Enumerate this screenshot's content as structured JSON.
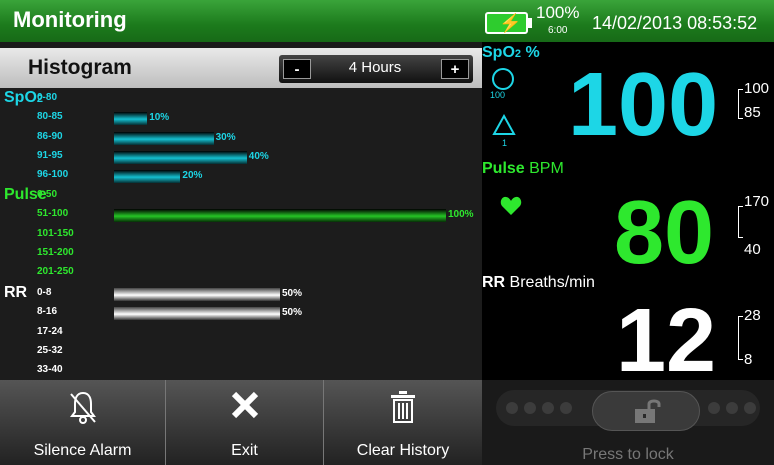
{
  "header": {
    "title": "Monitoring",
    "battery_pct": "100%",
    "battery_time": "6:00",
    "datetime": "14/02/2013 08:53:52"
  },
  "histogram": {
    "title": "Histogram",
    "range_value": "4 Hours",
    "minus_label": "-",
    "plus_label": "+",
    "spo2": {
      "name": "SpO",
      "sub": "2",
      "rows": [
        {
          "label": "0-80",
          "value": 0,
          "pct": ""
        },
        {
          "label": "80-85",
          "value": 10,
          "pct": "10%"
        },
        {
          "label": "86-90",
          "value": 30,
          "pct": "30%"
        },
        {
          "label": "91-95",
          "value": 40,
          "pct": "40%"
        },
        {
          "label": "96-100",
          "value": 20,
          "pct": "20%"
        }
      ]
    },
    "pulse": {
      "name": "Pulse",
      "rows": [
        {
          "label": "0-50",
          "value": 0,
          "pct": ""
        },
        {
          "label": "51-100",
          "value": 100,
          "pct": "100%"
        },
        {
          "label": "101-150",
          "value": 0,
          "pct": ""
        },
        {
          "label": "151-200",
          "value": 0,
          "pct": ""
        },
        {
          "label": "201-250",
          "value": 0,
          "pct": ""
        }
      ]
    },
    "rr": {
      "name": "RR",
      "rows": [
        {
          "label": "0-8",
          "value": 50,
          "pct": "50%"
        },
        {
          "label": "8-16",
          "value": 50,
          "pct": "50%"
        },
        {
          "label": "17-24",
          "value": 0,
          "pct": ""
        },
        {
          "label": "25-32",
          "value": 0,
          "pct": ""
        },
        {
          "label": "33-40",
          "value": 0,
          "pct": ""
        }
      ]
    }
  },
  "footer": {
    "silence_label": "Silence Alarm",
    "exit_label": "Exit",
    "clear_label": "Clear History"
  },
  "vitals": {
    "spo2": {
      "label_main": "SpO",
      "label_sub": "2",
      "label_unit": " %",
      "value": "100",
      "upper": "100",
      "lower": "85",
      "icon_circle_value": "100",
      "icon_triangle_value": "1"
    },
    "pulse": {
      "label_main": "Pulse",
      "label_unit": " BPM",
      "value": "80",
      "upper": "170",
      "lower": "40"
    },
    "rr": {
      "label_main": "RR",
      "label_unit": " Breaths/min",
      "value": "12",
      "upper": "28",
      "lower": "8"
    }
  },
  "lock": {
    "label": "Press to lock"
  },
  "colors": {
    "spo2": "#1dd6e6",
    "pulse": "#2ee82e",
    "rr": "#ffffff",
    "header": "#1c7a1c"
  }
}
